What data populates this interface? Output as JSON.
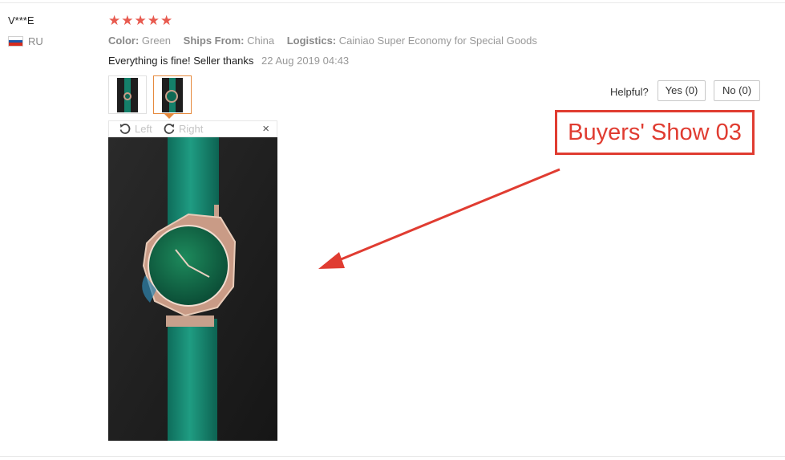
{
  "reviewer": {
    "name": "V***E",
    "country_code": "RU"
  },
  "rating": {
    "stars": 5,
    "max": 5
  },
  "attributes": [
    {
      "label": "Color:",
      "value": "Green"
    },
    {
      "label": "Ships From:",
      "value": "China"
    },
    {
      "label": "Logistics:",
      "value": "Cainiao Super Economy for Special Goods"
    }
  ],
  "review": {
    "text": "Everything is fine! Seller thanks",
    "date": "22 Aug 2019 04:43"
  },
  "photos": {
    "count": 2,
    "selected_index": 1
  },
  "viewer": {
    "rotate_left_label": "Left",
    "rotate_right_label": "Right",
    "close_glyph": "×"
  },
  "helpful": {
    "label": "Helpful?",
    "yes_label": "Yes (0)",
    "no_label": "No (0)"
  },
  "callout": {
    "text": "Buyers' Show 03"
  },
  "colors": {
    "accent": "#e03c31",
    "star": "#e85a4f",
    "selected_border": "#e68a3e"
  }
}
